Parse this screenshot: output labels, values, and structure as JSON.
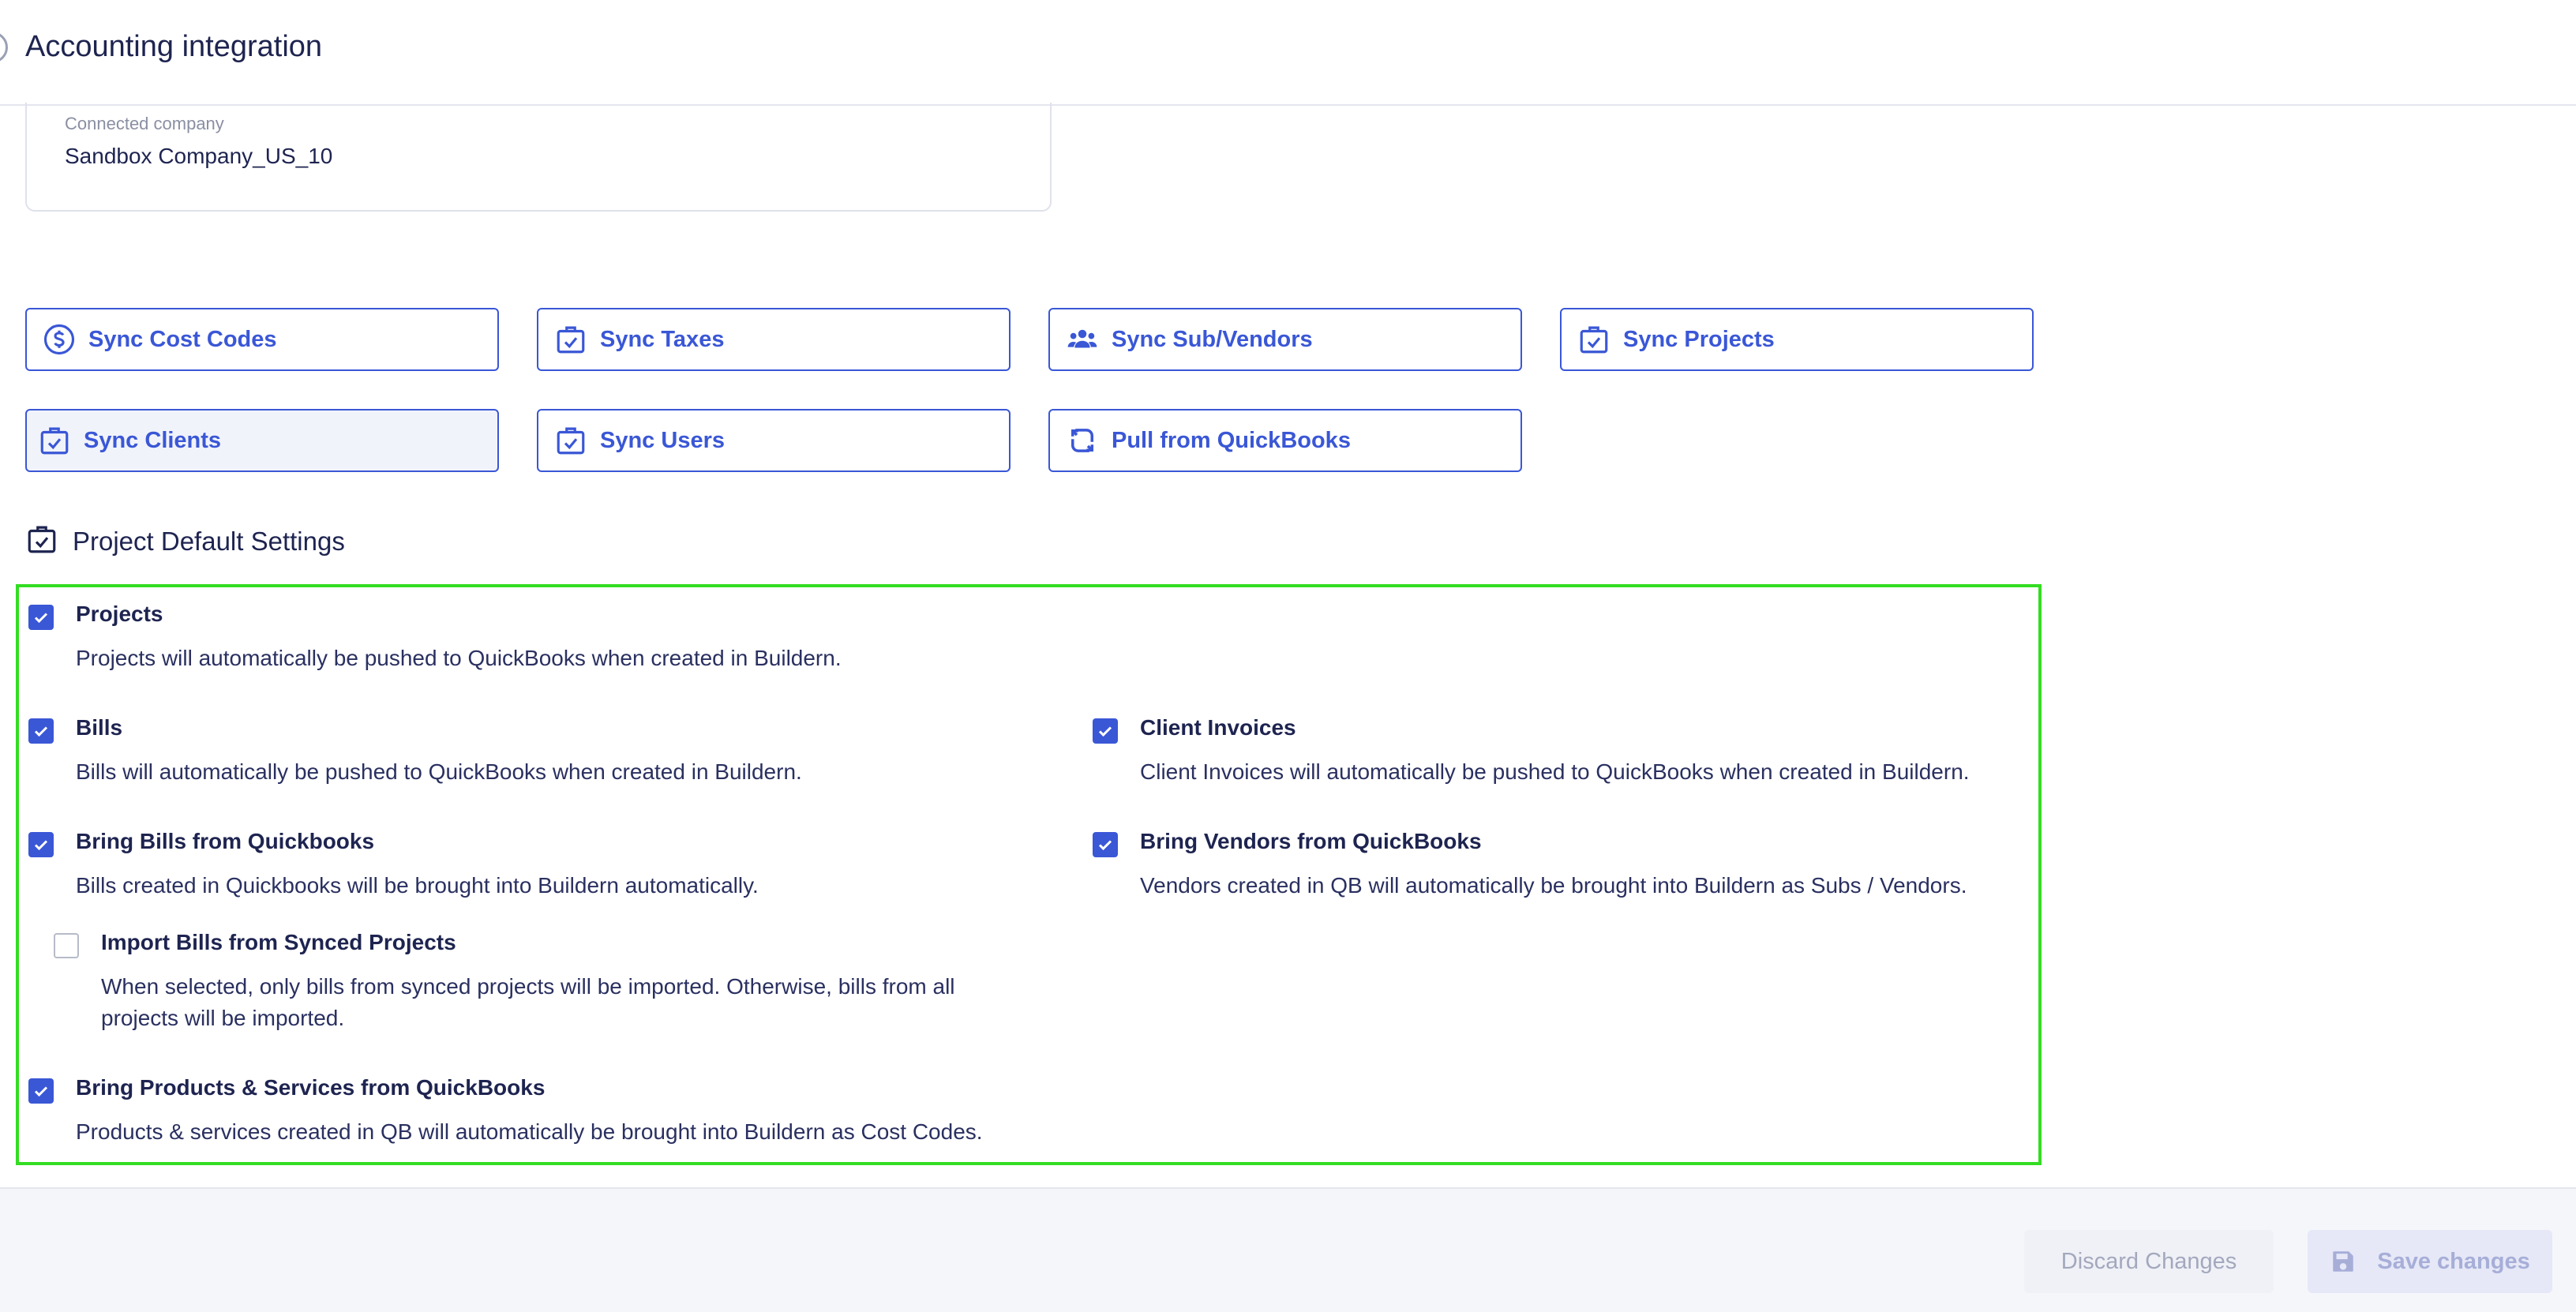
{
  "header": {
    "title": "Accounting integration"
  },
  "company": {
    "label": "Connected company",
    "value": "Sandbox Company_US_10"
  },
  "sync_buttons": [
    {
      "label": "Sync Cost Codes",
      "icon": "dollar-circle-icon"
    },
    {
      "label": "Sync Taxes",
      "icon": "clipboard-check-icon"
    },
    {
      "label": "Sync Sub/Vendors",
      "icon": "users-icon"
    },
    {
      "label": "Sync Projects",
      "icon": "clipboard-check-icon"
    },
    {
      "label": "Sync Clients",
      "icon": "clipboard-check-icon",
      "active": true
    },
    {
      "label": "Sync Users",
      "icon": "clipboard-check-icon"
    },
    {
      "label": "Pull from QuickBooks",
      "icon": "refresh-icon"
    }
  ],
  "section": {
    "title": "Project Default Settings",
    "icon": "clipboard-check-icon"
  },
  "options": {
    "projects": {
      "title": "Projects",
      "desc": "Projects will automatically be pushed to QuickBooks when created in Buildern.",
      "checked": true
    },
    "bills": {
      "title": "Bills",
      "desc": "Bills will automatically be pushed to QuickBooks when created in Buildern.",
      "checked": true
    },
    "client_invoices": {
      "title": "Client Invoices",
      "desc": "Client Invoices will automatically be pushed to QuickBooks when created in Buildern.",
      "checked": true
    },
    "bring_bills": {
      "title": "Bring Bills from Quickbooks",
      "desc": "Bills created in Quickbooks will be brought into Buildern automatically.",
      "checked": true
    },
    "bring_vendors": {
      "title": "Bring Vendors from QuickBooks",
      "desc": "Vendors created in QB will automatically be brought into Buildern as Subs / Vendors.",
      "checked": true
    },
    "import_bills": {
      "title": "Import Bills from Synced Projects",
      "desc": "When selected, only bills from synced projects will be imported. Otherwise, bills from all projects will be imported.",
      "checked": false
    },
    "bring_products": {
      "title": "Bring Products & Services from QuickBooks",
      "desc": "Products & services created in QB will automatically be brought into Buildern as Cost Codes.",
      "checked": true
    }
  },
  "footer": {
    "discard_label": "Discard Changes",
    "save_label": "Save changes"
  },
  "colors": {
    "accent": "#3a57d6",
    "text": "#1e2450",
    "highlight_border": "#33dd22"
  }
}
